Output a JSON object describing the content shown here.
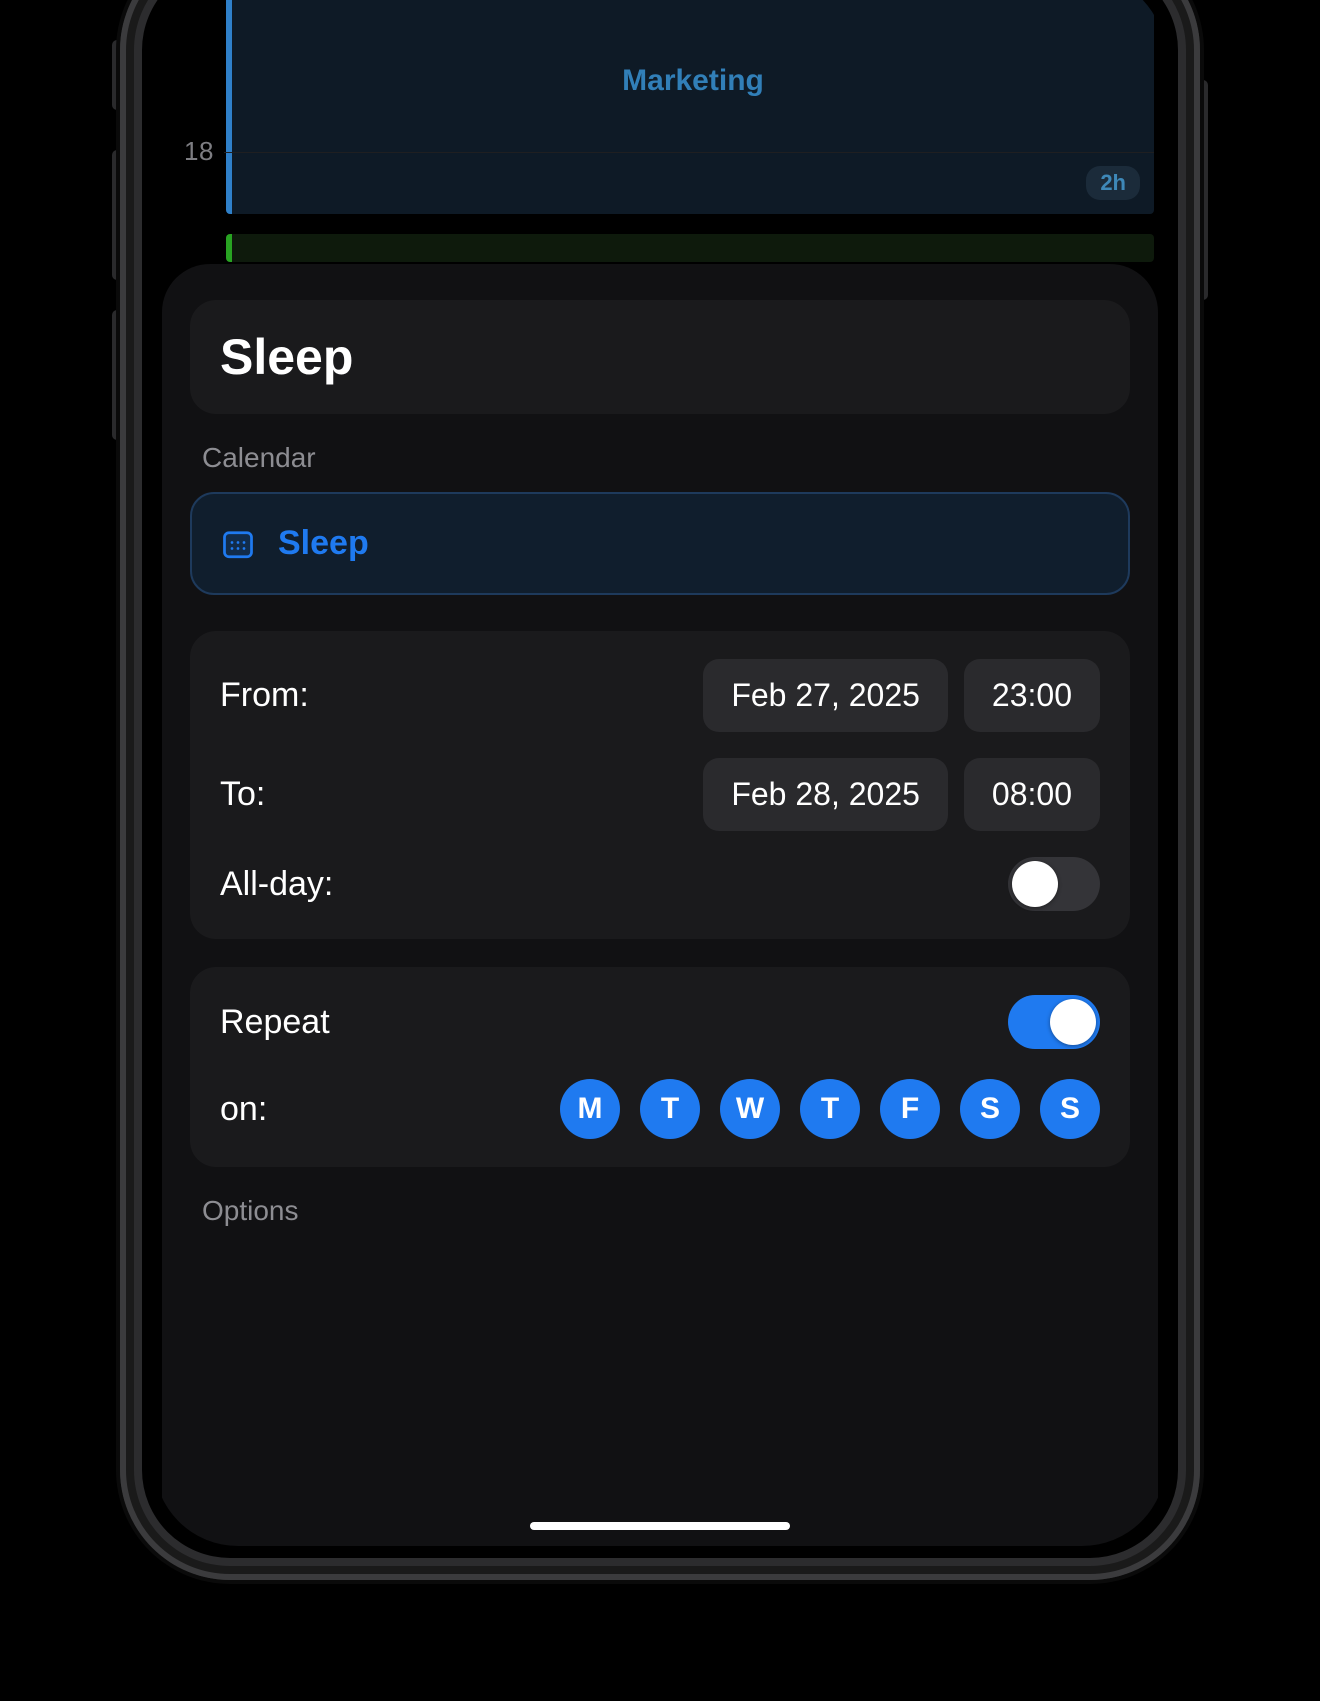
{
  "calendar_bg": {
    "hour_label": "18",
    "event_title": "Marketing",
    "event_duration": "2h"
  },
  "sheet": {
    "title": "Sleep",
    "calendar_section_label": "Calendar",
    "calendar_selected": "Sleep",
    "from_label": "From:",
    "from_date": "Feb 27, 2025",
    "from_time": "23:00",
    "to_label": "To:",
    "to_date": "Feb 28, 2025",
    "to_time": "08:00",
    "allday_label": "All-day:",
    "allday_on": false,
    "repeat_label": "Repeat",
    "repeat_on": true,
    "on_label": "on:",
    "days": [
      "M",
      "T",
      "W",
      "T",
      "F",
      "S",
      "S"
    ],
    "options_label": "Options"
  }
}
